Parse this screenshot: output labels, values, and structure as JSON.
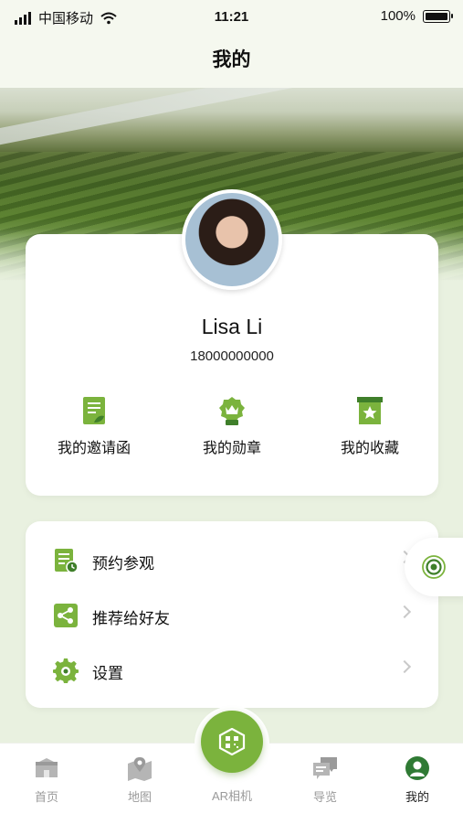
{
  "status_bar": {
    "carrier": "中国移动",
    "time": "11:21",
    "battery": "100%"
  },
  "nav": {
    "title": "我的"
  },
  "profile": {
    "name": "Lisa Li",
    "phone": "18000000000"
  },
  "quick_actions": [
    {
      "label": "我的邀请函",
      "icon": "invitation-icon"
    },
    {
      "label": "我的勋章",
      "icon": "medal-icon"
    },
    {
      "label": "我的收藏",
      "icon": "favorites-icon"
    }
  ],
  "menu": [
    {
      "label": "预约参观",
      "icon": "reservation-icon"
    },
    {
      "label": "推荐给好友",
      "icon": "share-icon"
    },
    {
      "label": "设置",
      "icon": "settings-gear-icon"
    }
  ],
  "tabs": [
    {
      "label": "首页",
      "icon": "home-icon"
    },
    {
      "label": "地图",
      "icon": "map-icon"
    },
    {
      "label": "AR相机",
      "icon": "ar-camera-icon"
    },
    {
      "label": "导览",
      "icon": "guide-chat-icon"
    },
    {
      "label": "我的",
      "icon": "profile-icon"
    }
  ],
  "colors": {
    "accent": "#7bb33d",
    "dark_green": "#3f7f2a",
    "background": "#e9f1e0"
  }
}
